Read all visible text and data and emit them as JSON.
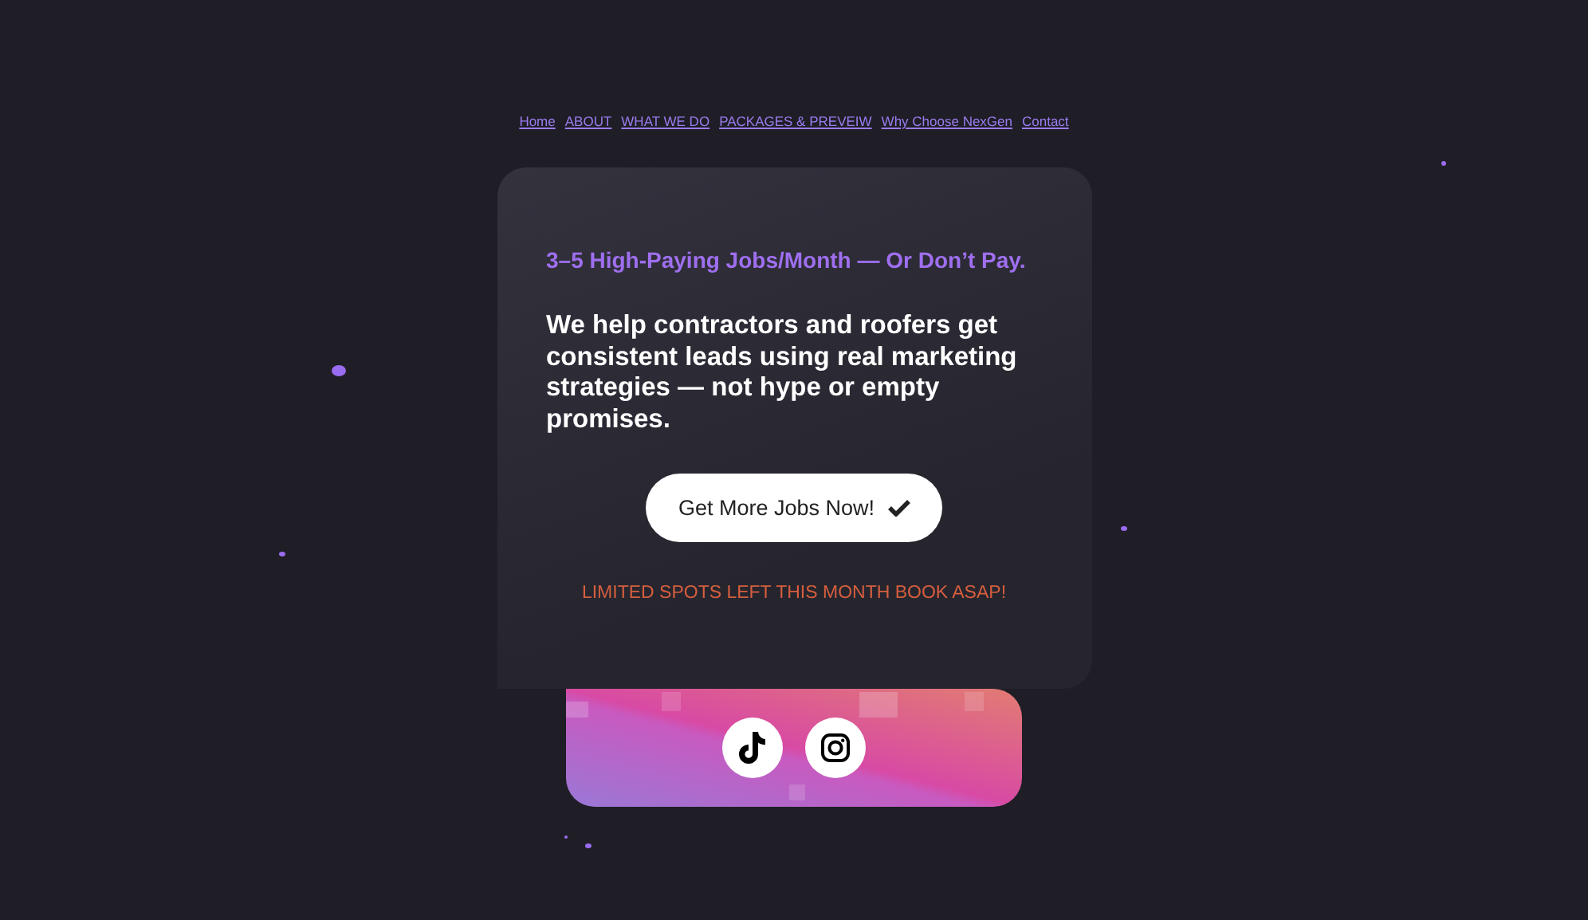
{
  "nav": [
    {
      "label": "Home"
    },
    {
      "label": "ABOUT"
    },
    {
      "label": "WHAT WE DO"
    },
    {
      "label": "PACKAGES & PREVEIW"
    },
    {
      "label": "Why Choose NexGen"
    },
    {
      "label": "Contact"
    }
  ],
  "hero": {
    "tagline": "3–5 High-Paying Jobs/Month — Or Don’t Pay.",
    "headline": "We help contractors and roofers get consistent leads using real marketing strategies — not hype or empty promises.",
    "cta": "Get More Jobs Now!",
    "notice": "LIMITED SPOTS LEFT THIS MONTH BOOK ASAP!"
  },
  "social": [
    {
      "kind": "tiktok"
    },
    {
      "kind": "instagram"
    }
  ]
}
